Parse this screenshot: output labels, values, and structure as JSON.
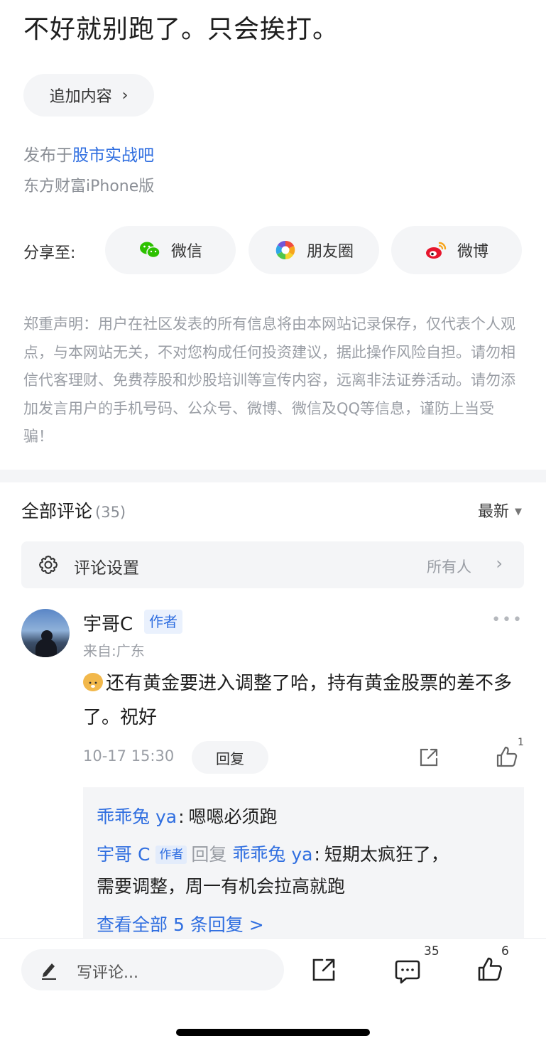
{
  "post": {
    "title": "不好就别跑了。只会挨打。",
    "append_label": "追加内容",
    "posted_in_prefix": "发布于",
    "forum_name": "股市实战吧",
    "source": "东方财富iPhone版"
  },
  "share": {
    "label": "分享至:",
    "wechat": "微信",
    "moments": "朋友圈",
    "weibo": "微博"
  },
  "disclaimer": "郑重声明：用户在社区发表的所有信息将由本网站记录保存，仅代表个人观点，与本网站无关，不对您构成任何投资建议，据此操作风险自担。请勿相信代客理财、免费荐股和炒股培训等宣传内容，远离非法证券活动。请勿添加发言用户的手机号码、公众号、微博、微信及QQ等信息，谨防上当受骗！",
  "comments": {
    "title": "全部评论",
    "count": "(35)",
    "sort_label": "最新",
    "settings_label": "评论设置",
    "settings_value": "所有人"
  },
  "comment": {
    "author": "宇哥C",
    "author_tag": "作者",
    "location": "来自:广东",
    "text": "还有黄金要进入调整了哈，持有黄金股票的差不多了。祝好",
    "time": "10-17 15:30",
    "reply_label": "回复",
    "like_count": "1"
  },
  "replies": {
    "r1_user": "乖乖兔 ya",
    "r1_text": "嗯嗯必须跑",
    "r2_user": "宇哥 C",
    "r2_tag": "作者",
    "r2_verb": "回复",
    "r2_target": "乖乖兔 ya",
    "r2_text": "短期太疯狂了，",
    "r2_text_cont": "需要调整，周一有机会拉高就跑",
    "view_all": "查看全部 5 条回复 >"
  },
  "bottom": {
    "placeholder": "写评论...",
    "comment_count": "35",
    "like_count": "6"
  },
  "colors": {
    "accent": "#2f6ee0",
    "muted": "#9a9ea5",
    "panel": "#f4f5f7"
  }
}
